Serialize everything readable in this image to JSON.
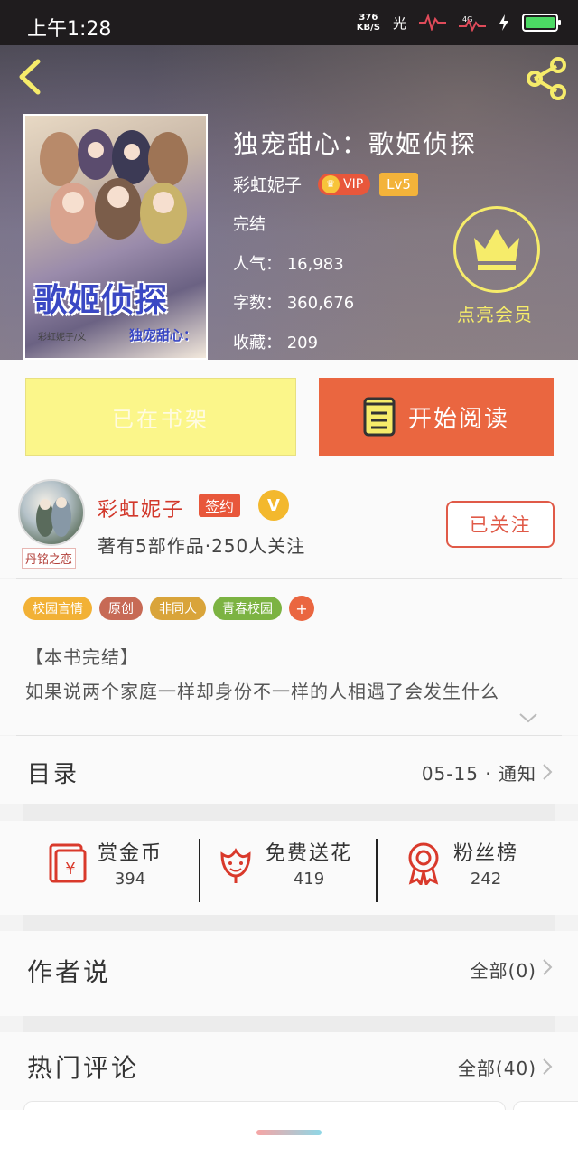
{
  "status_bar": {
    "time": "上午1:28",
    "speed_value": "376",
    "speed_unit": "KB/S",
    "carrier_label": "光"
  },
  "book": {
    "title": "独宠甜心：歌姬侦探",
    "author": "彩虹妮子",
    "vip_label": "VIP",
    "level": "Lv5",
    "status": "完结",
    "popularity": "人气：  16,983",
    "word_count": "字数：  360,676",
    "favorites": "收藏：  209",
    "member_label": "点亮会员",
    "cover": {
      "title": "歌姬侦探",
      "subtitle": "独宠甜心：",
      "author": "彩虹妮子/文"
    }
  },
  "actions": {
    "shelf_label": "已在书架",
    "read_label": "开始阅读"
  },
  "author_card": {
    "name": "彩虹妮子",
    "sign_badge": "签约",
    "v_badge": "V",
    "avatar_tag": "丹铭之恋",
    "stats": "著有5部作品·250人关注",
    "follow_label": "已关注"
  },
  "tags": [
    {
      "label": "校园言情",
      "color": "#f2b135"
    },
    {
      "label": "原创",
      "color": "#c76a55"
    },
    {
      "label": "非同人",
      "color": "#d9a43a"
    },
    {
      "label": "青春校园",
      "color": "#7cb342"
    }
  ],
  "tag_more": "+",
  "intro": {
    "line1": "【本书完结】",
    "line2": "如果说两个家庭一样却身份不一样的人相遇了会发生什么"
  },
  "catalog": {
    "label": "目录",
    "update": "05-15 · 通知"
  },
  "stats": {
    "reward": {
      "label": "赏金币",
      "value": "394"
    },
    "flower": {
      "label": "免费送花",
      "value": "419"
    },
    "fans": {
      "label": "粉丝榜",
      "value": "242"
    }
  },
  "author_says": {
    "label": "作者说",
    "all": "全部(0)"
  },
  "hot_comments": {
    "label": "热门评论",
    "all": "全部(40)"
  },
  "colors": {
    "accent": "#ea6640",
    "shelf_button": "#fbf68a",
    "member_gold": "#f6ec6a",
    "author_red": "#d2382b"
  }
}
